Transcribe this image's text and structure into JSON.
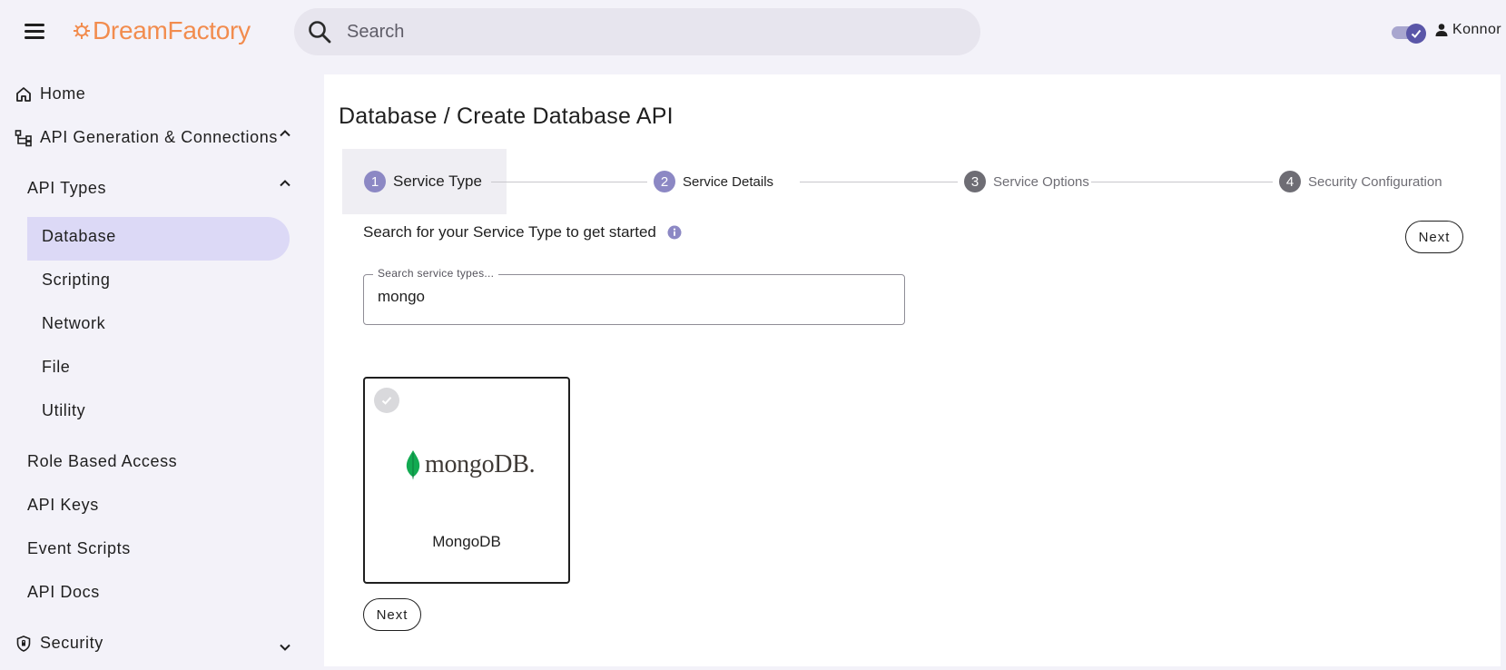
{
  "app": {
    "logo_text": "DreamFactory",
    "brand_color": "#f28c4e"
  },
  "header": {
    "search_placeholder": "Search",
    "user_name": "Konnor",
    "theme_toggle_on": true
  },
  "sidebar": {
    "home": "Home",
    "api_gen": "API Generation & Connections",
    "api_types": "API Types",
    "types": [
      "Database",
      "Scripting",
      "Network",
      "File",
      "Utility"
    ],
    "role_based_access": "Role Based Access",
    "api_keys": "API Keys",
    "event_scripts": "Event Scripts",
    "api_docs": "API Docs",
    "security": "Security",
    "active_item": "Database",
    "active_color": "#dcd9f6"
  },
  "main": {
    "title": "Database / Create Database API",
    "steps": [
      {
        "num": "1",
        "label": "Service Type"
      },
      {
        "num": "2",
        "label": "Service Details"
      },
      {
        "num": "3",
        "label": "Service Options"
      },
      {
        "num": "4",
        "label": "Security Configuration"
      }
    ],
    "intro": "Search for your Service Type to get started",
    "next_label": "Next",
    "search_label": "Search service types...",
    "search_value": "mongo",
    "card": {
      "name": "MongoDB",
      "logo_text": "mongoDB."
    },
    "colors": {
      "step_active": "#8c88c4",
      "step_inactive": "#6e6d74"
    }
  }
}
